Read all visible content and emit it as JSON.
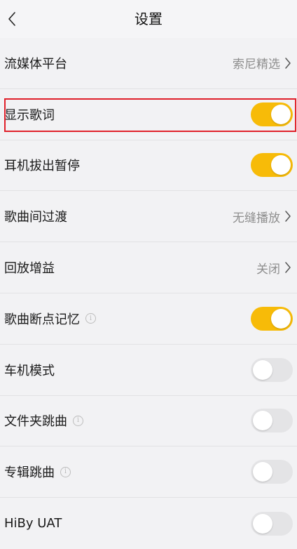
{
  "header": {
    "title": "设置",
    "back_icon": "chevron-left-icon"
  },
  "colors": {
    "accent": "#f7bb08",
    "highlight": "#e0202a",
    "toggle_off": "#e4e4e6"
  },
  "settings": [
    {
      "label": "流媒体平台",
      "type": "nav",
      "value": "索尼精选"
    },
    {
      "label": "显示歌词",
      "type": "toggle",
      "on": true,
      "highlighted": true
    },
    {
      "label": "耳机拔出暂停",
      "type": "toggle",
      "on": true
    },
    {
      "label": "歌曲间过渡",
      "type": "nav",
      "value": "无缝播放"
    },
    {
      "label": "回放增益",
      "type": "nav",
      "value": "关闭"
    },
    {
      "label": "歌曲断点记忆",
      "type": "toggle",
      "on": true,
      "info": true
    },
    {
      "label": "车机模式",
      "type": "toggle",
      "on": false
    },
    {
      "label": "文件夹跳曲",
      "type": "toggle",
      "on": false,
      "info": true
    },
    {
      "label": "专辑跳曲",
      "type": "toggle",
      "on": false,
      "info": true
    },
    {
      "label": "HiBy UAT",
      "type": "toggle",
      "on": false
    }
  ]
}
